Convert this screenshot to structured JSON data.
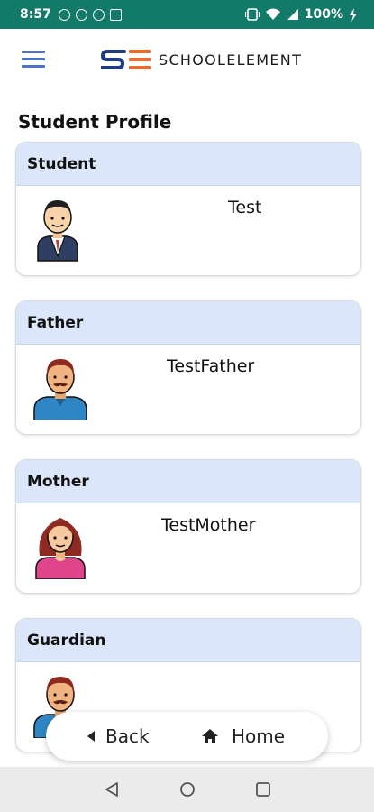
{
  "status_bar": {
    "time": "8:57",
    "battery": "100%"
  },
  "header": {
    "logo_mark": "SE",
    "logo_text": "SCHOOLELEMENT"
  },
  "page": {
    "title": "Student Profile"
  },
  "cards": [
    {
      "heading": "Student",
      "name": "Test",
      "avatar": "student-avatar"
    },
    {
      "heading": "Father",
      "name": "TestFather",
      "avatar": "father-avatar"
    },
    {
      "heading": "Mother",
      "name": "TestMother",
      "avatar": "mother-avatar"
    },
    {
      "heading": "Guardian",
      "name": "",
      "avatar": "guardian-avatar"
    }
  ],
  "bottom_bar": {
    "back_label": "Back",
    "home_label": "Home"
  },
  "colors": {
    "status_bar": "#137a6a",
    "card_header": "#dbe6fa",
    "accent_blue": "#1d3b8b",
    "accent_orange": "#f2692a"
  }
}
